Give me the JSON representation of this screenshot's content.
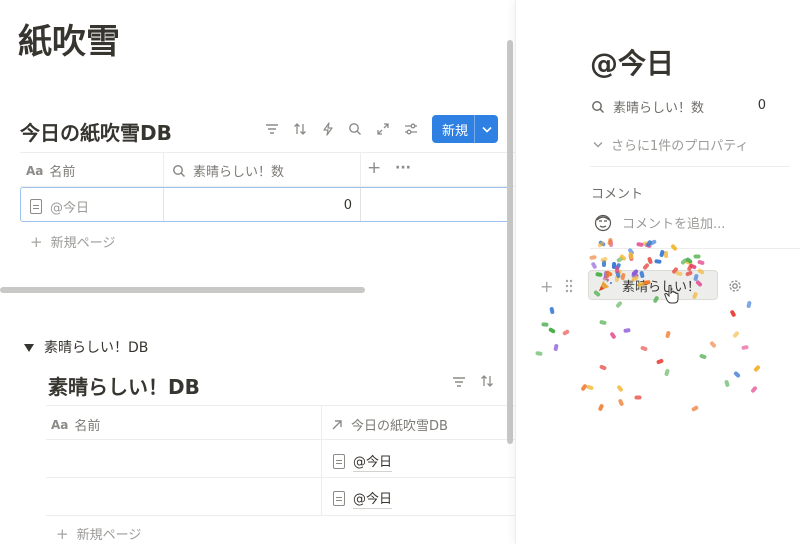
{
  "page": {
    "title": "紙吹雪"
  },
  "db1": {
    "title": "今日の紙吹雪DB",
    "new_label": "新規",
    "columns": [
      {
        "icon": "Aa",
        "label": "名前"
      },
      {
        "icon": "search-icon",
        "label": "素晴らしい！数"
      }
    ],
    "add_col": "+",
    "more": "···",
    "rows": [
      {
        "name": "@今日",
        "value": "0"
      }
    ],
    "new_page": "新規ページ"
  },
  "db2": {
    "toggle_label": "素晴らしい！DB",
    "title": "素晴らしい！DB",
    "columns": [
      {
        "icon": "Aa",
        "label": "名前"
      },
      {
        "icon": "arrow-up-right-icon",
        "label": "今日の紙吹雪DB"
      }
    ],
    "rows": [
      {
        "name": "",
        "relation": "@今日"
      },
      {
        "name": "",
        "relation": "@今日"
      }
    ],
    "new_page": "新規ページ"
  },
  "panel": {
    "title": "@今日",
    "property_label": "素晴らしい！数",
    "property_value": "0",
    "more_props": "さらに1件のプロパティ",
    "comment_heading": "コメント",
    "comment_placeholder": "コメントを追加...",
    "button_label": "素晴らしい！"
  },
  "colors": {
    "accent": "#2f80e3",
    "confetti": [
      "#e8473f",
      "#f2b632",
      "#3a7bd5",
      "#4cae4c",
      "#f07a2e",
      "#8a5bd6",
      "#e24a8d"
    ]
  }
}
